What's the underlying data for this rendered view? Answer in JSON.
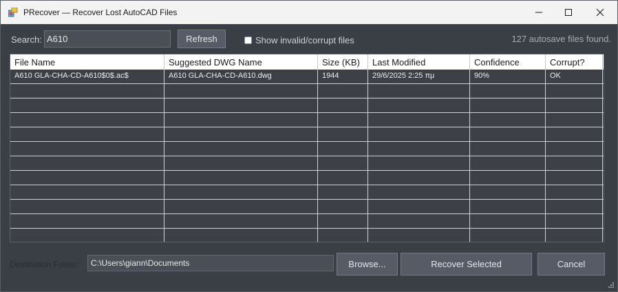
{
  "window": {
    "title": "PRecover — Recover Lost AutoCAD Files"
  },
  "toolbar": {
    "search_label": "Search:",
    "search_value": "A610",
    "refresh_label": "Refresh",
    "show_invalid_label": "Show invalid/corrupt files",
    "show_invalid_checked": false,
    "status_count": "127 autosave files found."
  },
  "table": {
    "columns": [
      "File Name",
      "Suggested DWG Name",
      "Size (KB)",
      "Last Modified",
      "Confidence",
      "Corrupt?"
    ],
    "rows": [
      [
        "A610 GLA-CHA-CD-A610$0$.ac$",
        "A610 GLA-CHA-CD-A610.dwg",
        "1944",
        "29/6/2025 2:25 πμ",
        "90%",
        "OK"
      ]
    ]
  },
  "footer": {
    "destination_label": "Destination Folder:",
    "destination_value": "C:\\Users\\giann\\Documents",
    "browse_label": "Browse...",
    "recover_label": "Recover Selected",
    "cancel_label": "Cancel"
  },
  "icons": {
    "app": "app-icon",
    "minimize": "minimize-icon",
    "maximize": "maximize-icon",
    "close": "close-icon"
  }
}
